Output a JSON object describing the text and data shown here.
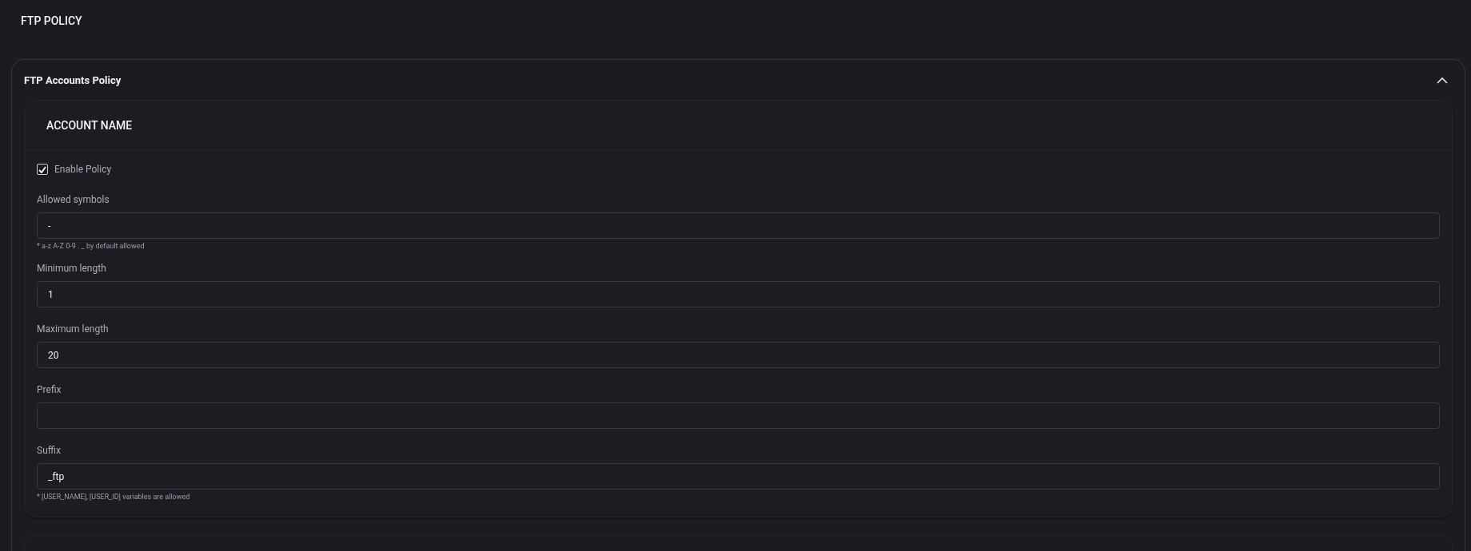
{
  "page_title": "FTP POLICY",
  "panel": {
    "title": "FTP Accounts Policy",
    "expanded": true,
    "section": {
      "title": "ACCOUNT NAME",
      "enable_policy": {
        "label": "Enable Policy",
        "checked": true
      },
      "fields": [
        {
          "label": "Allowed symbols",
          "value": "-",
          "hint": "* a-z A-Z 0-9 . _ by default allowed"
        },
        {
          "label": "Minimum length",
          "value": "1"
        },
        {
          "label": "Maximum length",
          "value": "20"
        },
        {
          "label": "Prefix"
        },
        {
          "label": "Suffix",
          "value": "_ftp",
          "hint": "* [USER_NAME], [USER_ID] variables are allowed"
        }
      ]
    }
  }
}
